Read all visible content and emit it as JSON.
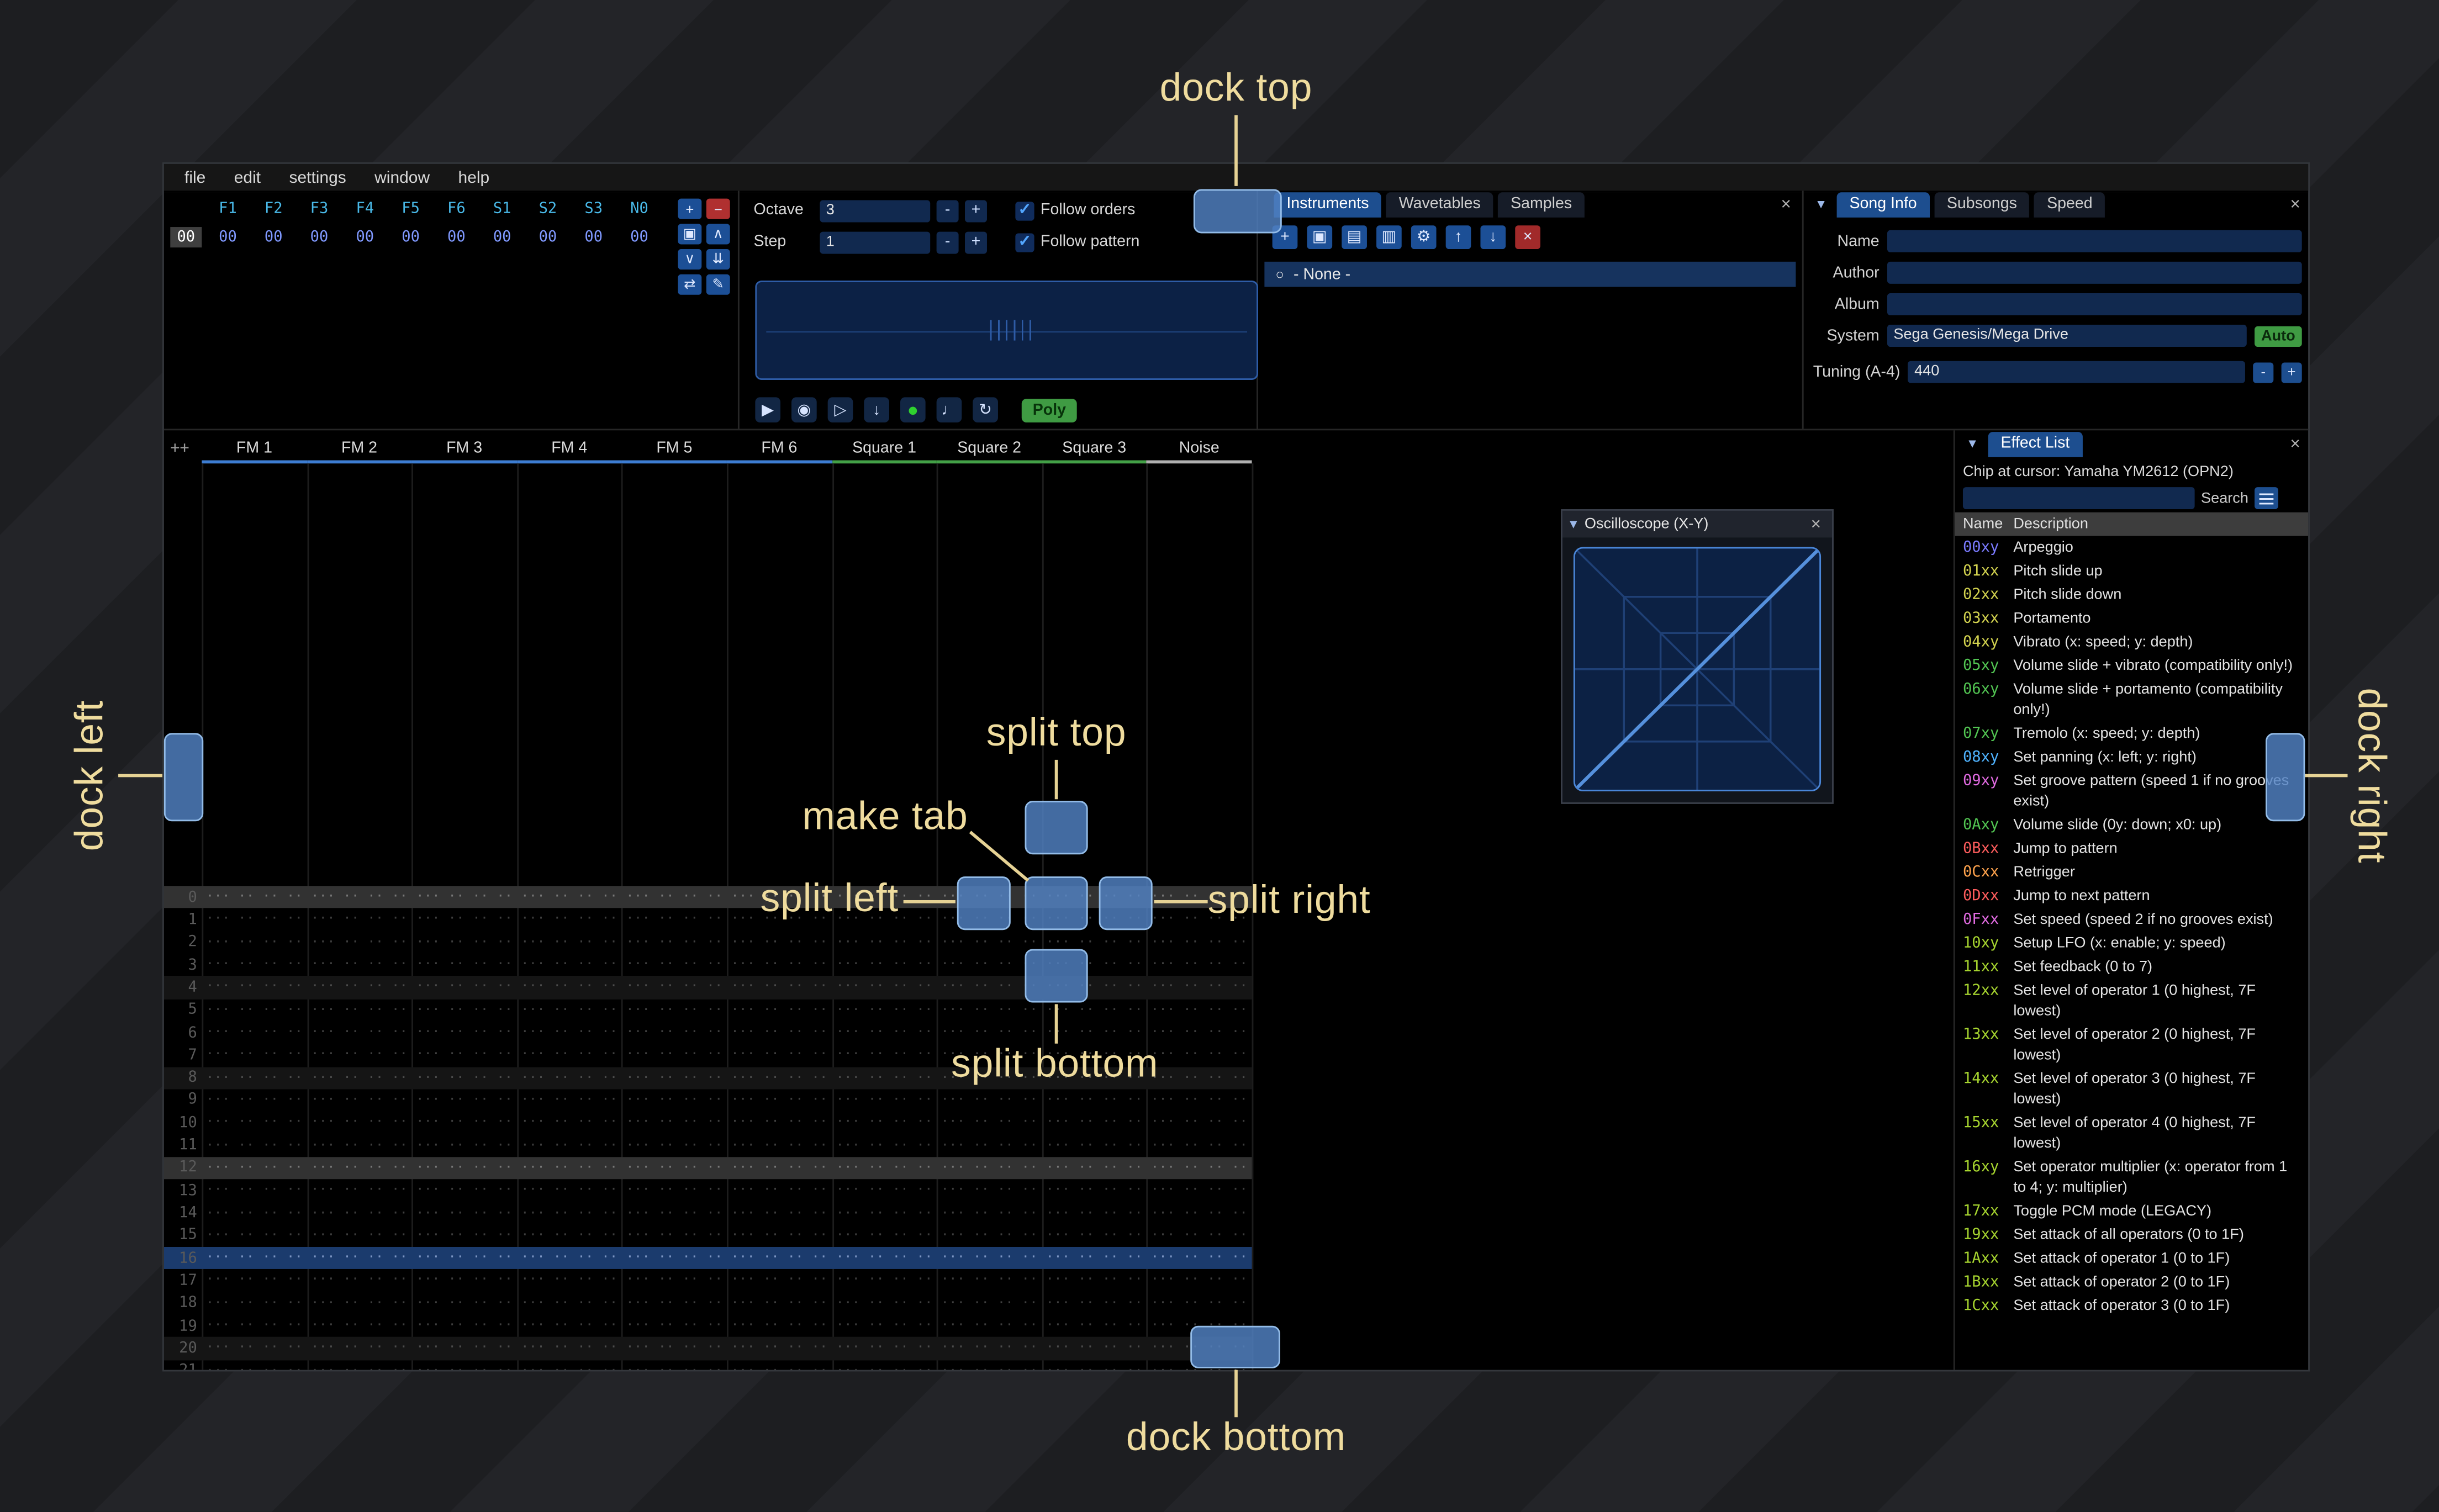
{
  "ui": {
    "minus": "-",
    "plus": "+",
    "close": "×",
    "collapse": "▼",
    "radio": "○",
    "check": "✓"
  },
  "annotations": {
    "dock_top": "dock top",
    "dock_bottom": "dock bottom",
    "dock_left": "dock left",
    "dock_right": "dock right",
    "split_top": "split top",
    "split_bottom": "split bottom",
    "split_left": "split left",
    "split_right": "split right",
    "make_tab": "make tab"
  },
  "menu": {
    "items": [
      "file",
      "edit",
      "settings",
      "window",
      "help"
    ]
  },
  "orders": {
    "channel_headers": [
      "F1",
      "F2",
      "F3",
      "F4",
      "F5",
      "F6",
      "S1",
      "S2",
      "S3",
      "N0"
    ],
    "row_index": "00",
    "row_values": [
      "00",
      "00",
      "00",
      "00",
      "00",
      "00",
      "00",
      "00",
      "00",
      "00"
    ],
    "toolbar": [
      {
        "name": "add",
        "glyph": "+",
        "variant": "blue"
      },
      {
        "name": "remove",
        "glyph": "−",
        "variant": "red"
      },
      {
        "name": "duplicate",
        "glyph": "▣",
        "variant": "blue"
      },
      {
        "name": "move-up",
        "glyph": "∧",
        "variant": "blue"
      },
      {
        "name": "move-down",
        "glyph": "∨",
        "variant": "blue"
      },
      {
        "name": "duplicate-deep",
        "glyph": "⇊",
        "variant": "blue"
      },
      {
        "name": "change-all",
        "glyph": "⇄",
        "variant": "blue"
      },
      {
        "name": "edit-mode",
        "glyph": "✎",
        "variant": "blue"
      }
    ]
  },
  "transport": {
    "octave_label": "Octave",
    "octave_value": "3",
    "step_label": "Step",
    "step_value": "1",
    "follow_orders_label": "Follow orders",
    "follow_pattern_label": "Follow pattern",
    "poly_label": "Poly",
    "buttons": [
      {
        "name": "play",
        "glyph": "▶"
      },
      {
        "name": "play-pattern",
        "glyph": "◉"
      },
      {
        "name": "play-from-cursor",
        "glyph": "▷"
      },
      {
        "name": "step-one-row",
        "glyph": "↓"
      },
      {
        "name": "record",
        "glyph": "●",
        "variant": "green"
      },
      {
        "name": "metronome",
        "glyph": "♩"
      },
      {
        "name": "repeat-pattern",
        "glyph": "↻"
      }
    ]
  },
  "assets": {
    "tabs": [
      "Instruments",
      "Wavetables",
      "Samples"
    ],
    "active_tab_index": 0,
    "toolbar": [
      {
        "name": "add",
        "glyph": "+",
        "variant": "blue"
      },
      {
        "name": "duplicate",
        "glyph": "▣",
        "variant": "blue"
      },
      {
        "name": "open",
        "glyph": "▤",
        "variant": "blue"
      },
      {
        "name": "save",
        "glyph": "▥",
        "variant": "blue"
      },
      {
        "name": "toggle-folders",
        "glyph": "⚙",
        "variant": "blue"
      },
      {
        "name": "move-up",
        "glyph": "↑",
        "variant": "blue"
      },
      {
        "name": "move-down",
        "glyph": "↓",
        "variant": "blue"
      },
      {
        "name": "delete",
        "glyph": "×",
        "variant": "red"
      }
    ],
    "items": [
      "- None -"
    ]
  },
  "song_info": {
    "tabs": [
      "Song Info",
      "Subsongs",
      "Speed"
    ],
    "active_tab_index": 0,
    "name_label": "Name",
    "name_value": "",
    "author_label": "Author",
    "author_value": "",
    "album_label": "Album",
    "album_value": "",
    "system_label": "System",
    "system_value": "Sega Genesis/Mega Drive",
    "auto_label": "Auto",
    "tuning_label": "Tuning (A-4)",
    "tuning_value": "440"
  },
  "pattern": {
    "corner_label": "++",
    "channels": [
      {
        "name": "FM 1",
        "type": "fm"
      },
      {
        "name": "FM 2",
        "type": "fm"
      },
      {
        "name": "FM 3",
        "type": "fm"
      },
      {
        "name": "FM 4",
        "type": "fm"
      },
      {
        "name": "FM 5",
        "type": "fm"
      },
      {
        "name": "FM 6",
        "type": "fm"
      },
      {
        "name": "Square 1",
        "type": "square"
      },
      {
        "name": "Square 2",
        "type": "square"
      },
      {
        "name": "Square 3",
        "type": "square"
      },
      {
        "name": "Noise",
        "type": "noise"
      }
    ],
    "channel_type_colors": {
      "fm": "#3d7dd2",
      "square": "#43a047",
      "noise": "#b0b0b0"
    },
    "visible_rows": 22,
    "highlight_rows_strong": [
      0,
      12
    ],
    "highlight_rows_weak": [
      4,
      8,
      20
    ],
    "highlight_rows_blue": [
      16
    ],
    "empty_cell": "··· ·· ·· ··"
  },
  "oscilloscope": {
    "title": "Oscilloscope (X-Y)"
  },
  "effects": {
    "panel_title": "Effect List",
    "chip_line": "Chip at cursor: Yamaha YM2612 (OPN2)",
    "search_value": "",
    "search_label": "Search",
    "columns": [
      "Name",
      "Description"
    ],
    "rows": [
      {
        "code": "00xy",
        "color": "#7b7bff",
        "desc": "Arpeggio"
      },
      {
        "code": "01xx",
        "color": "#d3d34f",
        "desc": "Pitch slide up"
      },
      {
        "code": "02xx",
        "color": "#d3d34f",
        "desc": "Pitch slide down"
      },
      {
        "code": "03xx",
        "color": "#d3d34f",
        "desc": "Portamento"
      },
      {
        "code": "04xy",
        "color": "#d3d34f",
        "desc": "Vibrato (x: speed; y: depth)"
      },
      {
        "code": "05xy",
        "color": "#52c552",
        "desc": "Volume slide + vibrato (compatibility only!)"
      },
      {
        "code": "06xy",
        "color": "#52c552",
        "desc": "Volume slide + portamento (compatibility only!)"
      },
      {
        "code": "07xy",
        "color": "#52c552",
        "desc": "Tremolo (x: speed; y: depth)"
      },
      {
        "code": "08xy",
        "color": "#4fb3ff",
        "desc": "Set panning (x: left; y: right)"
      },
      {
        "code": "09xy",
        "color": "#e06ae0",
        "desc": "Set groove pattern (speed 1 if no grooves exist)"
      },
      {
        "code": "0Axy",
        "color": "#52c552",
        "desc": "Volume slide (0y: down; x0: up)"
      },
      {
        "code": "0Bxx",
        "color": "#ff5d5d",
        "desc": "Jump to pattern"
      },
      {
        "code": "0Cxx",
        "color": "#ffa34d",
        "desc": "Retrigger"
      },
      {
        "code": "0Dxx",
        "color": "#ff5d5d",
        "desc": "Jump to next pattern"
      },
      {
        "code": "0Fxx",
        "color": "#e06ae0",
        "desc": "Set speed (speed 2 if no grooves exist)"
      },
      {
        "code": "10xy",
        "color": "#a6d42f",
        "desc": "Setup LFO (x: enable; y: speed)"
      },
      {
        "code": "11xx",
        "color": "#a6d42f",
        "desc": "Set feedback (0 to 7)"
      },
      {
        "code": "12xx",
        "color": "#a6d42f",
        "desc": "Set level of operator 1 (0 highest, 7F lowest)"
      },
      {
        "code": "13xx",
        "color": "#a6d42f",
        "desc": "Set level of operator 2 (0 highest, 7F lowest)"
      },
      {
        "code": "14xx",
        "color": "#a6d42f",
        "desc": "Set level of operator 3 (0 highest, 7F lowest)"
      },
      {
        "code": "15xx",
        "color": "#a6d42f",
        "desc": "Set level of operator 4 (0 highest, 7F lowest)"
      },
      {
        "code": "16xy",
        "color": "#a6d42f",
        "desc": "Set operator multiplier (x: operator from 1 to 4; y: multiplier)"
      },
      {
        "code": "17xx",
        "color": "#a6d42f",
        "desc": "Toggle PCM mode (LEGACY)"
      },
      {
        "code": "19xx",
        "color": "#a6d42f",
        "desc": "Set attack of all operators (0 to 1F)"
      },
      {
        "code": "1Axx",
        "color": "#a6d42f",
        "desc": "Set attack of operator 1 (0 to 1F)"
      },
      {
        "code": "1Bxx",
        "color": "#a6d42f",
        "desc": "Set attack of operator 2 (0 to 1F)"
      },
      {
        "code": "1Cxx",
        "color": "#a6d42f",
        "desc": "Set attack of operator 3 (0 to 1F)"
      }
    ]
  }
}
